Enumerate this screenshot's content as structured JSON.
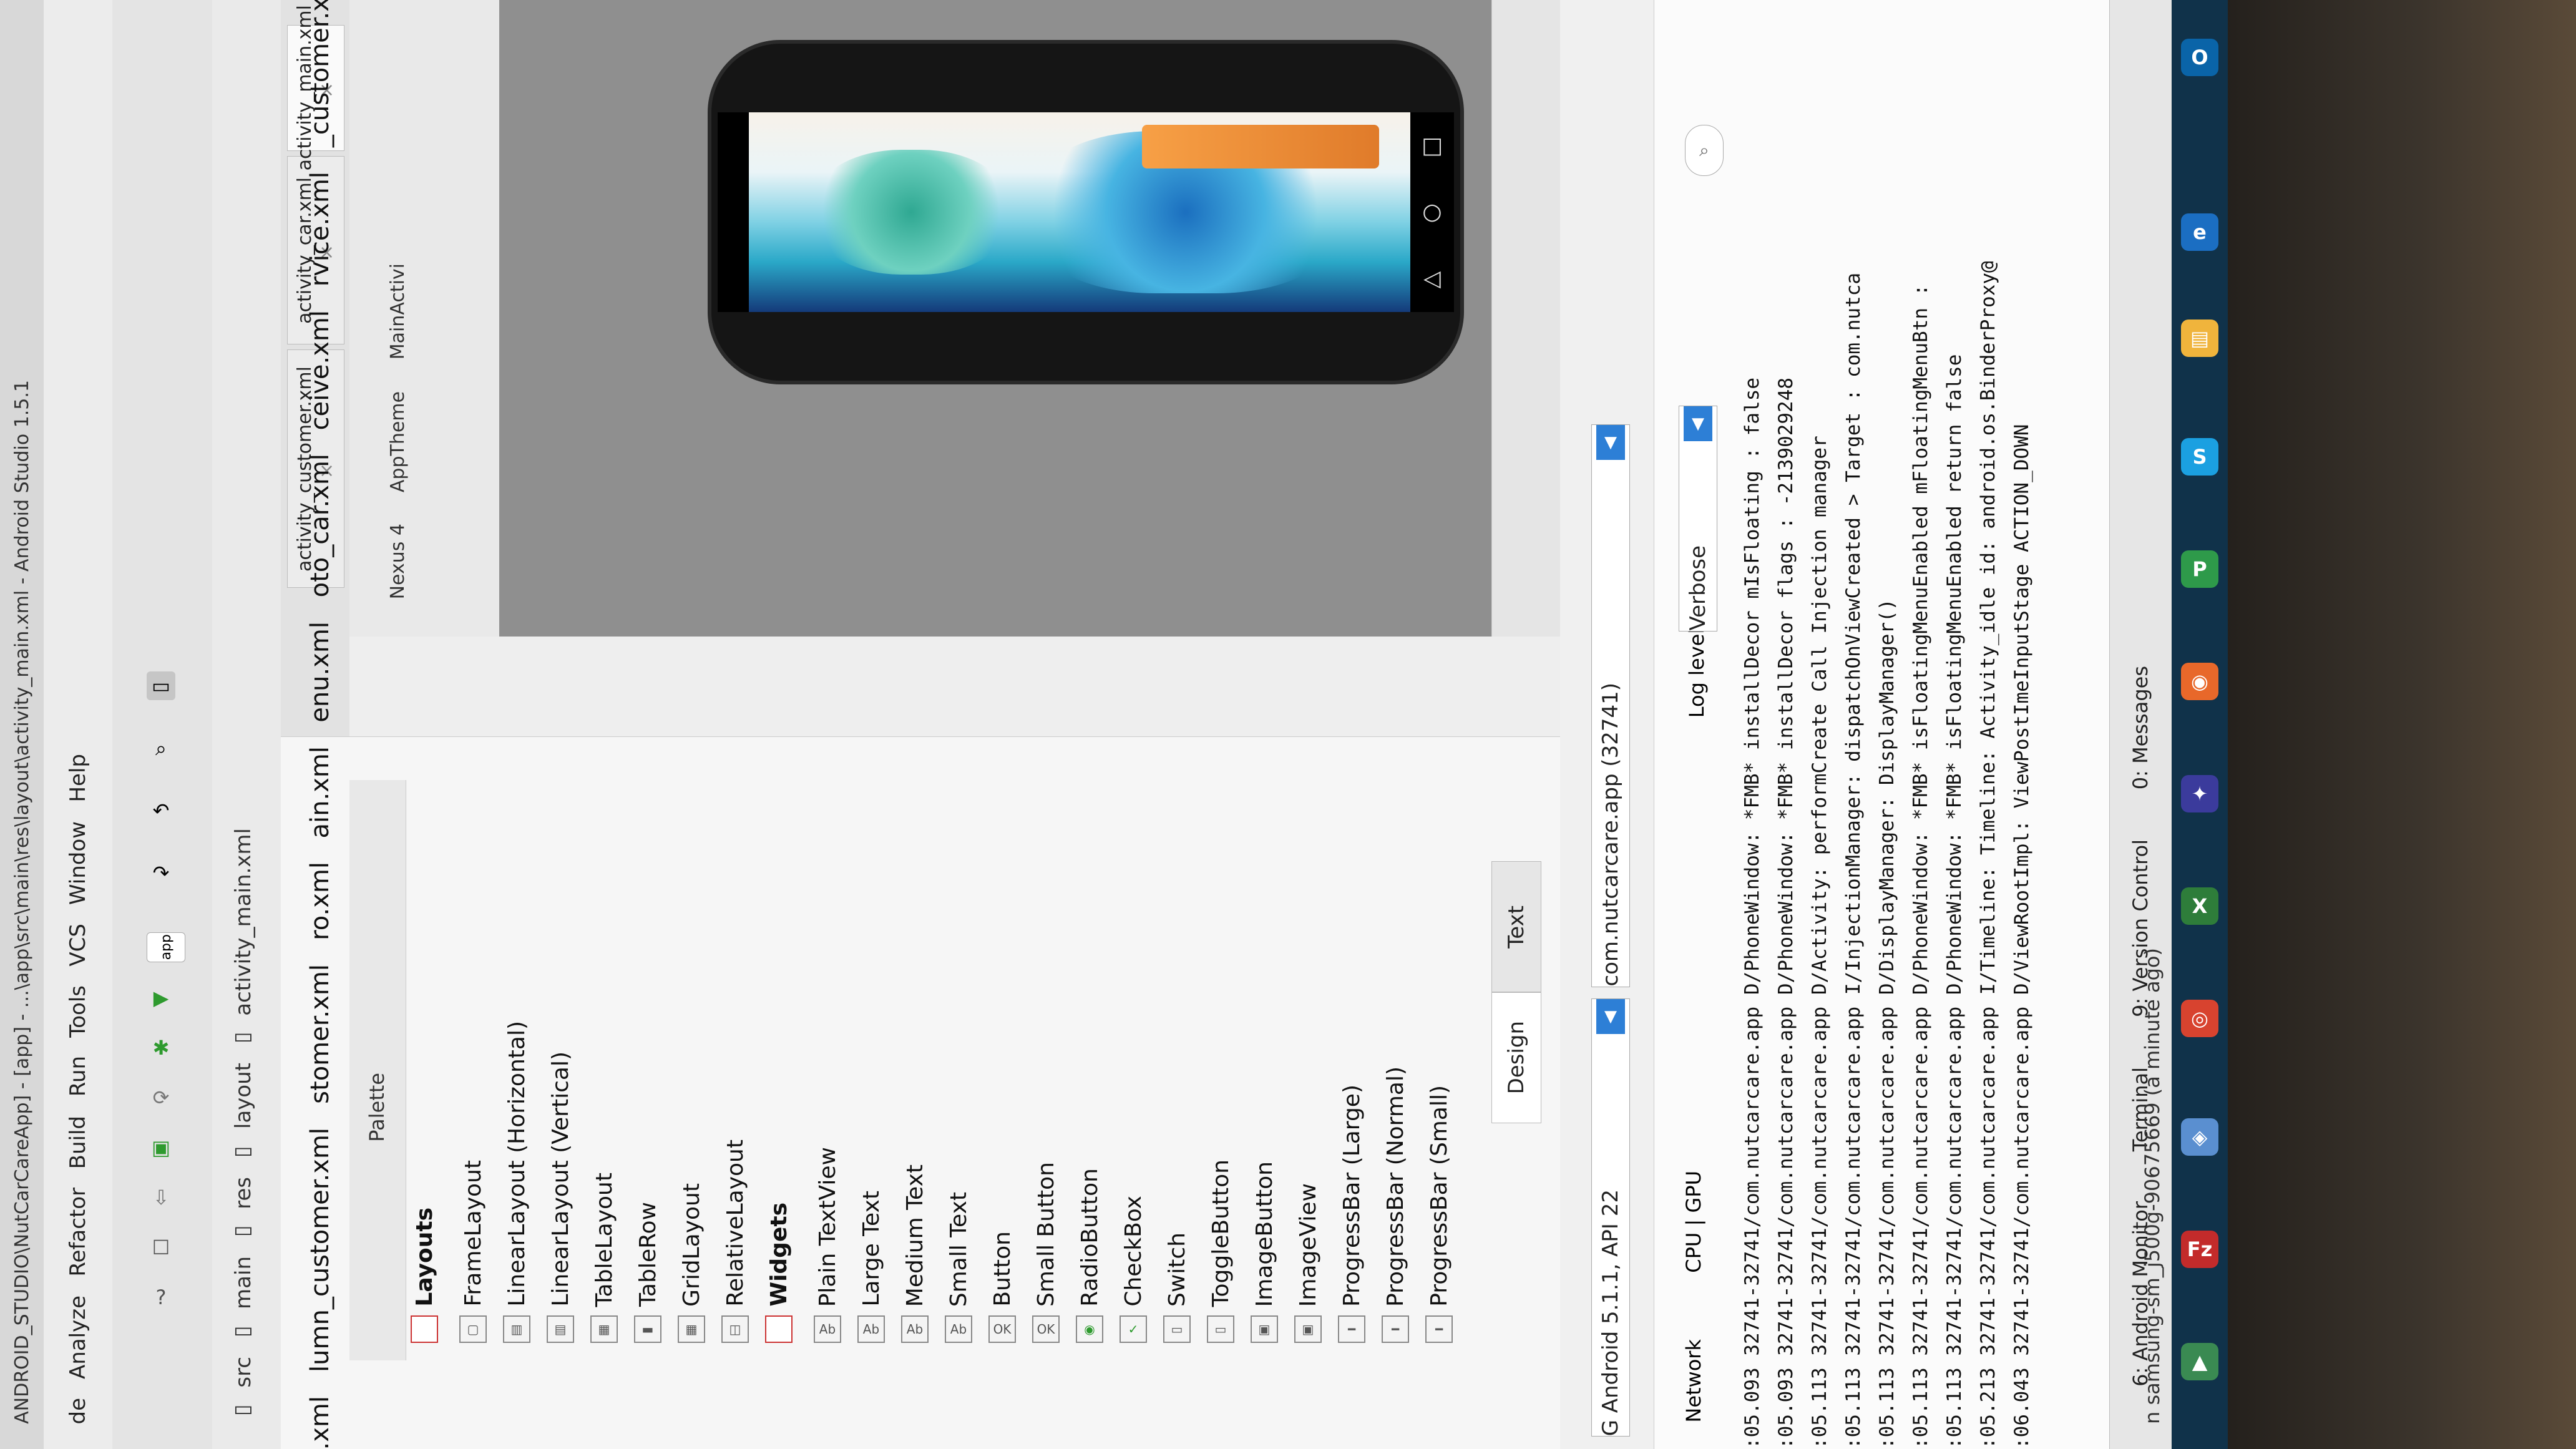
{
  "window": {
    "title": "ANDROID_STUDIO\\NutCarCareApp] - [app] - ...\\app\\src\\main\\res\\layout\\activity_main.xml - Android Studio 1.5.1"
  },
  "menu": [
    "de",
    "Analyze",
    "Refactor",
    "Build",
    "Run",
    "Tools",
    "VCS",
    "Window",
    "Help"
  ],
  "toolbar": {
    "module": "app"
  },
  "breadcrumbs": [
    "src",
    "main",
    "res",
    "layout",
    "activity_main.xml"
  ],
  "editor_tabs": [
    {
      "label": "activity_customer.xml",
      "active": false
    },
    {
      "label": "activity_car.xml",
      "active": false
    },
    {
      "label": "activity_main.xml",
      "active": true
    }
  ],
  "project_files": [
    ".xml",
    "lumn_customer.xml",
    "stomer.xml",
    "ro.xml",
    "ain.xml",
    "enu.xml",
    "oto_car.xml",
    "ceive.xml",
    "rvice.xml",
    "_customer.xml",
    "xml"
  ],
  "palette": {
    "title": "Palette",
    "items": [
      {
        "type": "group",
        "label": "Layouts"
      },
      {
        "type": "item",
        "label": "FrameLayout",
        "icon": "frame"
      },
      {
        "type": "item",
        "label": "LinearLayout (Horizontal)",
        "icon": "linear-h"
      },
      {
        "type": "item",
        "label": "LinearLayout (Vertical)",
        "icon": "linear-v"
      },
      {
        "type": "item",
        "label": "TableLayout",
        "icon": "table"
      },
      {
        "type": "item",
        "label": "TableRow",
        "icon": "row"
      },
      {
        "type": "item",
        "label": "GridLayout",
        "icon": "grid"
      },
      {
        "type": "item",
        "label": "RelativeLayout",
        "icon": "relative"
      },
      {
        "type": "group",
        "label": "Widgets"
      },
      {
        "type": "item",
        "label": "Plain TextView",
        "icon": "Ab"
      },
      {
        "type": "item",
        "label": "Large Text",
        "icon": "Ab"
      },
      {
        "type": "item",
        "label": "Medium Text",
        "icon": "Ab"
      },
      {
        "type": "item",
        "label": "Small Text",
        "icon": "Ab"
      },
      {
        "type": "item",
        "label": "Button",
        "icon": "OK"
      },
      {
        "type": "item",
        "label": "Small Button",
        "icon": "OK"
      },
      {
        "type": "item",
        "label": "RadioButton",
        "icon": "radio"
      },
      {
        "type": "item",
        "label": "CheckBox",
        "icon": "check"
      },
      {
        "type": "item",
        "label": "Switch",
        "icon": "switch"
      },
      {
        "type": "item",
        "label": "ToggleButton",
        "icon": "toggle"
      },
      {
        "type": "item",
        "label": "ImageButton",
        "icon": "imgbtn"
      },
      {
        "type": "item",
        "label": "ImageView",
        "icon": "img"
      },
      {
        "type": "item",
        "label": "ProgressBar (Large)",
        "icon": "bar"
      },
      {
        "type": "item",
        "label": "ProgressBar (Normal)",
        "icon": "bar"
      },
      {
        "type": "item",
        "label": "ProgressBar (Small)",
        "icon": "bar"
      }
    ]
  },
  "design_tabs": {
    "design": "Design",
    "text": "Text"
  },
  "preview": {
    "device": "Nexus 4",
    "theme": "AppTheme",
    "activity": "MainActivi"
  },
  "monitor": {
    "device": "G Android 5.1.1, API 22",
    "process": "com.nutcarcare.app (32741)",
    "log_level_label": "Log level:",
    "log_level": "Verbose",
    "tabs": [
      "CPU | GPU",
      "Network"
    ],
    "lines": [
      ":05.093 32741-32741/com.nutcarcare.app D/PhoneWindow: *FMB* installDecor mIsFloating : false",
      ":05.093 32741-32741/com.nutcarcare.app D/PhoneWindow: *FMB* installDecor flags : -2139029248",
      ":05.113 32741-32741/com.nutcarcare.app D/Activity: performCreate Call Injection manager",
      ":05.113 32741-32741/com.nutcarcare.app I/InjectionManager: dispatchOnViewCreated > Target : com.nutca",
      ":05.113 32741-32741/com.nutcarcare.app D/DisplayManager: DisplayManager()",
      ":05.113 32741-32741/com.nutcarcare.app D/PhoneWindow: *FMB* isFloatingMenuEnabled mFloatingMenuBtn : ",
      ":05.113 32741-32741/com.nutcarcare.app D/PhoneWindow: *FMB* isFloatingMenuEnabled return false",
      ":05.213 32741-32741/com.nutcarcare.app I/Timeline: Timeline: Activity_idle id: android.os.BinderProxy@",
      ":06.043 32741-32741/com.nutcarcare.app D/ViewRootImpl: ViewPostImeInputStage ACTION_DOWN"
    ]
  },
  "tool_windows": [
    "6: Android Monitor",
    "Terminal",
    "9: Version Control",
    "0: Messages"
  ],
  "status": "n samsung-sm_j500g-90675669 (a minute ago)",
  "colors": {
    "accent": "#2d7fd6",
    "ide_bg": "#eeeeee",
    "orange": "#e07b2a"
  }
}
